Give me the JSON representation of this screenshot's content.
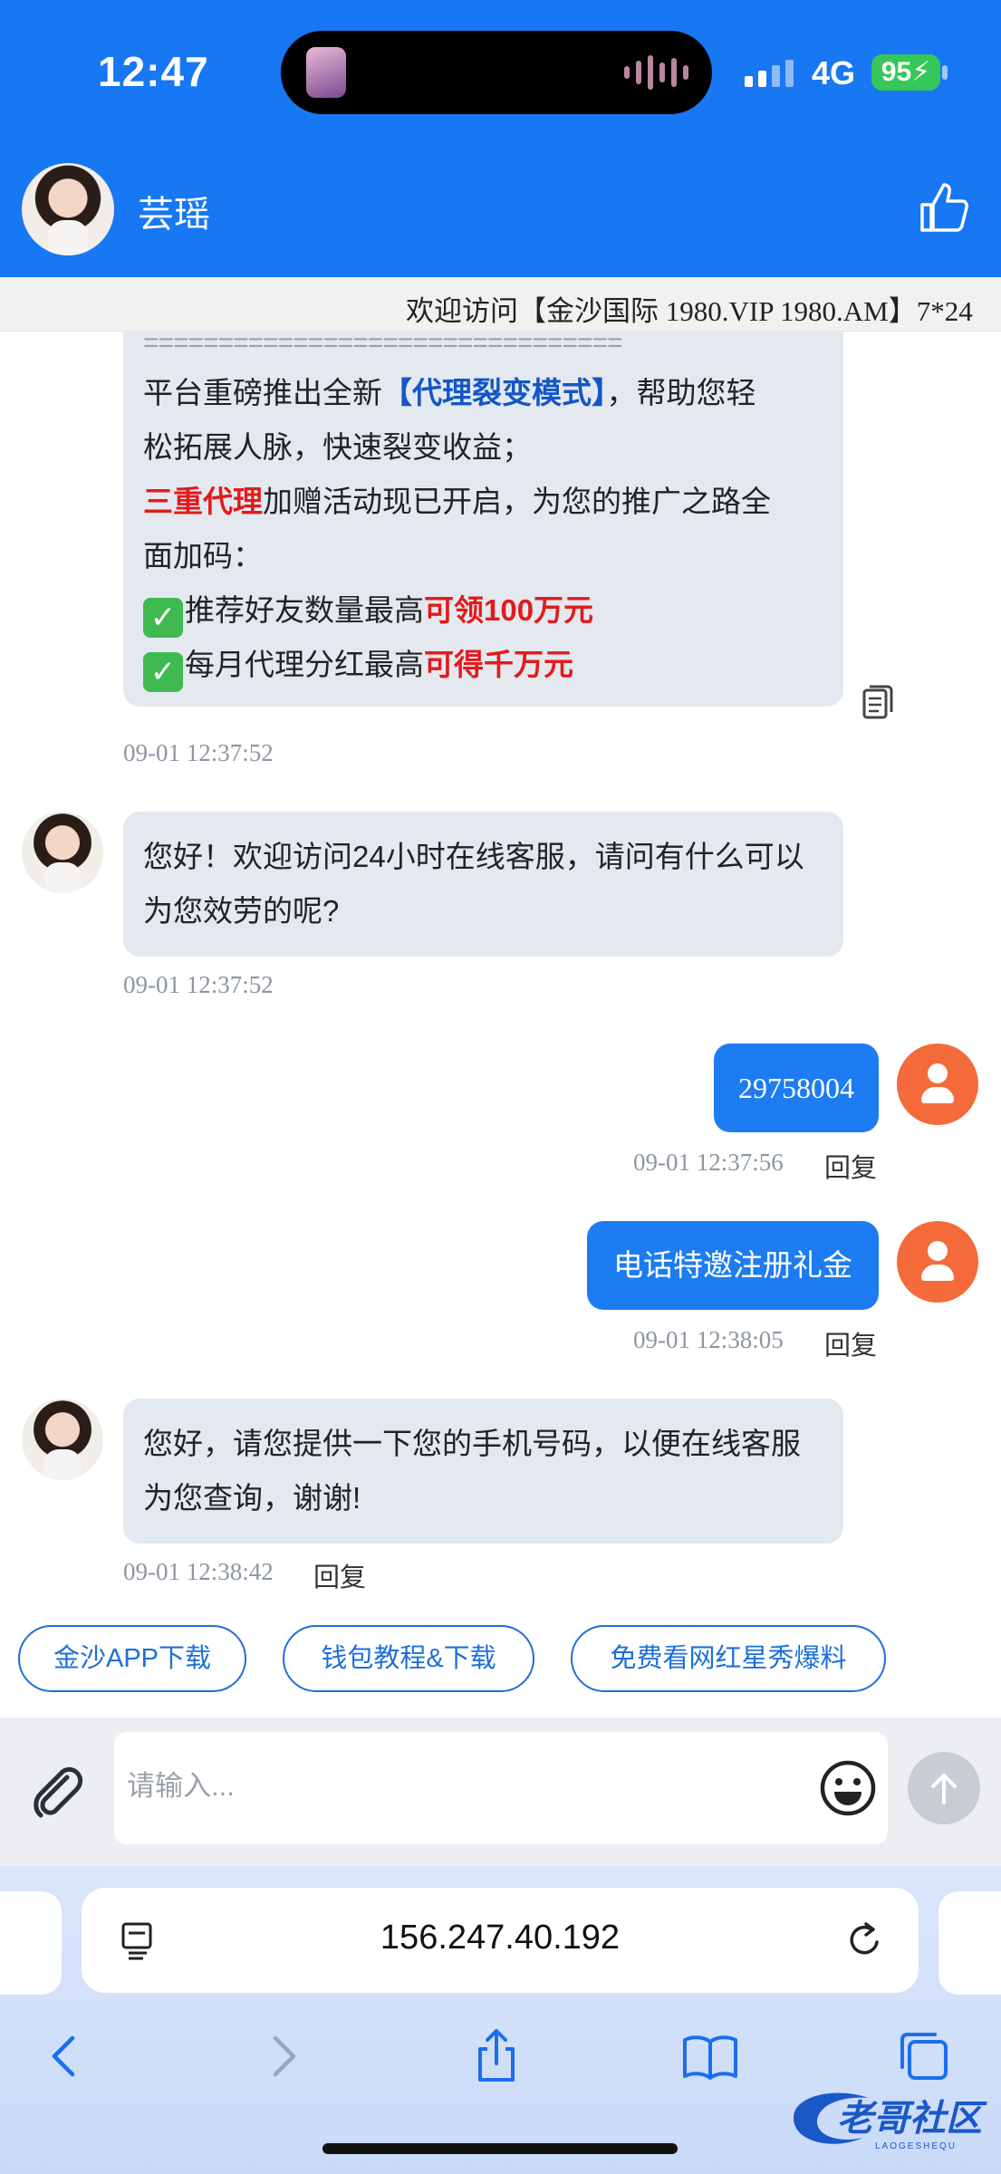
{
  "status_bar": {
    "time": "12:47",
    "network": "4G",
    "battery": "95"
  },
  "header": {
    "agent_name": "芸瑶"
  },
  "marquee": {
    "text": "欢迎访问【金沙国际 1980.VIP 1980.AM】7*24"
  },
  "messages": {
    "m1": {
      "divider": "================================",
      "l1_a": "平台重磅推出全新",
      "l1_b": "【代理裂变模式】",
      "l1_c": "，帮助您轻",
      "l2": "松拓展人脉，快速裂变收益；",
      "l3_a": "三重代理",
      "l3_b": "加赠活动现已开启，为您的推广之路全",
      "l4": "面加码：",
      "l5_a": "推荐好友数量最高",
      "l5_b": "可领100万元",
      "l6_a": "每月代理分红最高",
      "l6_b": "可得千万元",
      "time": "09-01 12:37:52"
    },
    "m2": {
      "text": "您好！欢迎访问24小时在线客服，请问有什么可以为您效劳的呢?",
      "time": "09-01 12:37:52"
    },
    "m3": {
      "text": "29758004",
      "time": "09-01 12:37:56",
      "reply": "回复"
    },
    "m4": {
      "text": "电话特邀注册礼金",
      "time": "09-01 12:38:05",
      "reply": "回复"
    },
    "m5": {
      "text": "您好，请您提供一下您的手机号码，以便在线客服为您查询，谢谢!",
      "time": "09-01 12:38:42",
      "reply": "回复"
    }
  },
  "quick_actions": [
    "金沙APP下载",
    "钱包教程&下载",
    "免费看网红星秀爆料"
  ],
  "composer": {
    "placeholder": "请输入..."
  },
  "browser": {
    "url": "156.247.40.192"
  },
  "watermark": {
    "text": "老哥社区",
    "sub": "LAOGESHEQU"
  },
  "colors": {
    "brand_blue": "#1877f2",
    "bubble_out": "#1e7cf2",
    "bubble_in": "#e4e9f0",
    "user_avatar": "#f46a3a",
    "highlight_red": "#e31b1b"
  },
  "icons": [
    "thumbs-up-icon",
    "copy-icon",
    "paperclip-icon",
    "emoji-icon",
    "send-arrow-icon",
    "tabs-icon",
    "reload-icon",
    "back-icon",
    "forward-icon",
    "share-icon",
    "bookmarks-icon",
    "tab-switcher-icon"
  ]
}
